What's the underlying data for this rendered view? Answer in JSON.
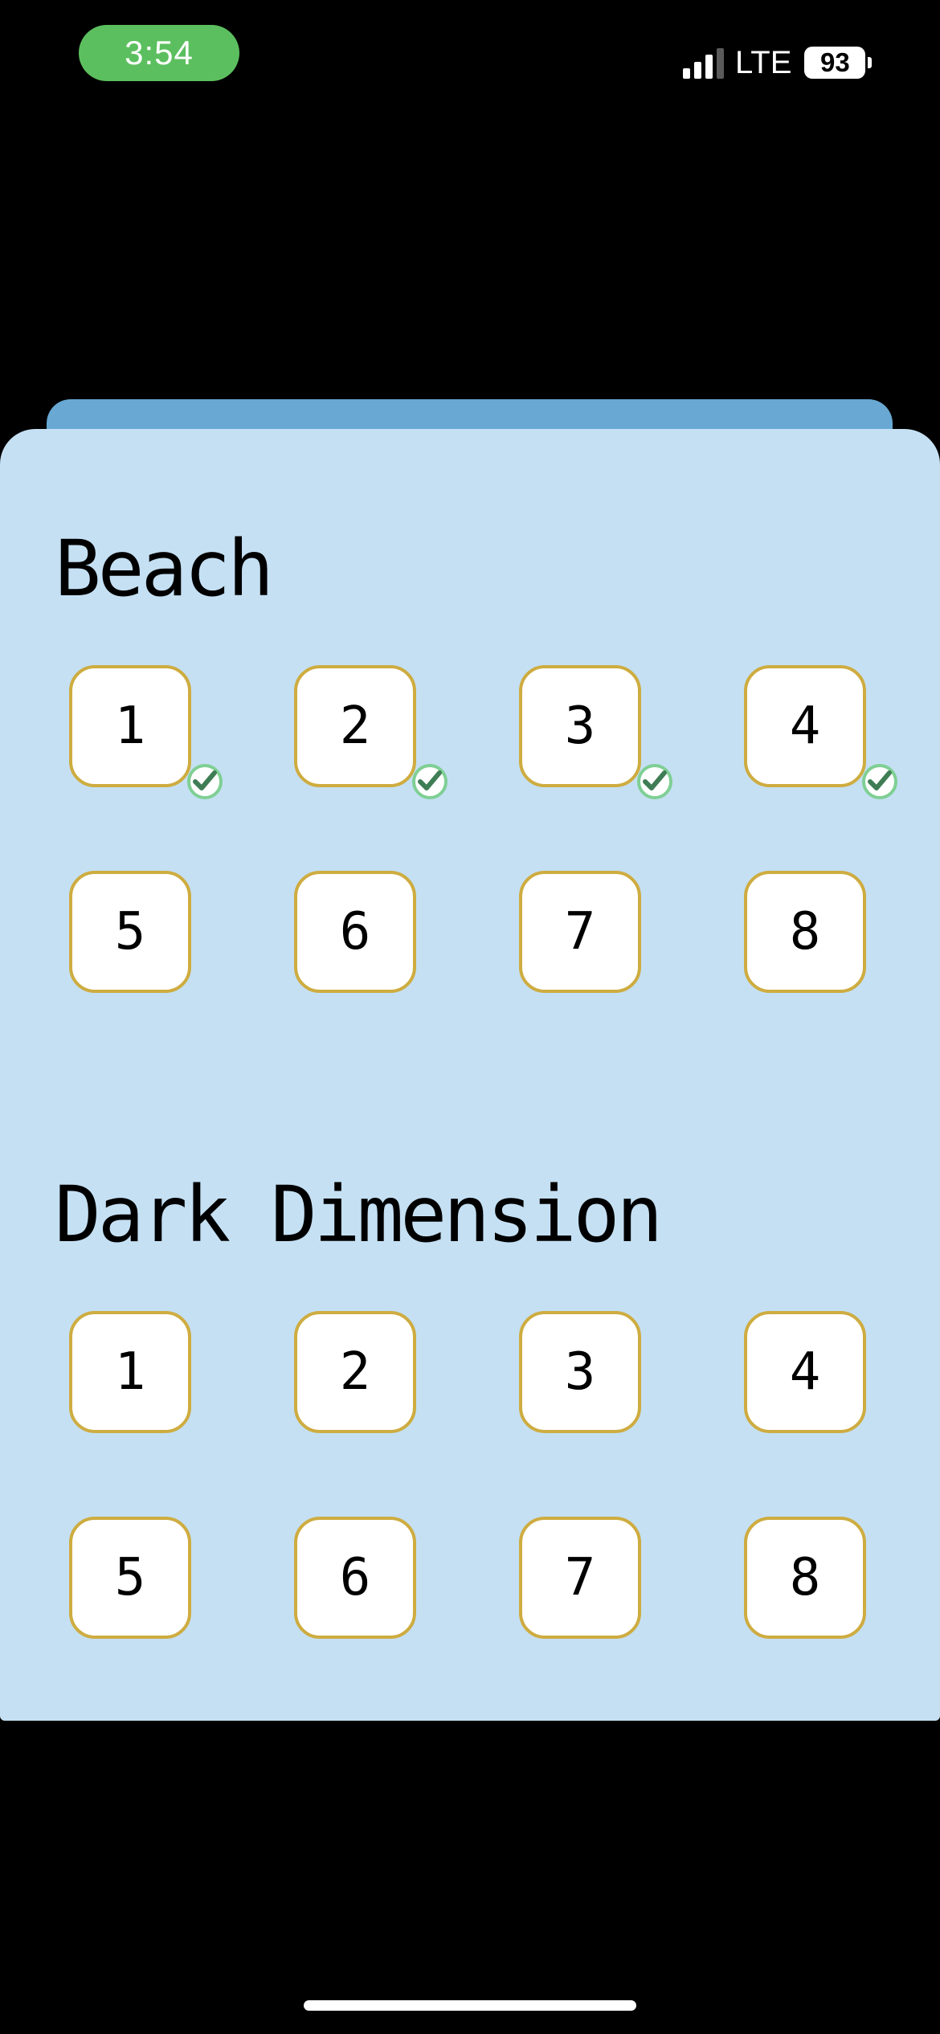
{
  "status_bar": {
    "time": "3:54",
    "network": "LTE",
    "battery": "93",
    "signal_bars_active": 3,
    "signal_bars_total": 4
  },
  "colors": {
    "background": "#000000",
    "time_pill": "#5cbf5f",
    "card": "#c5e0f3",
    "card_tab": "#68a8d3",
    "level_border": "#ceac40",
    "check_fill": "#3f7d55",
    "check_ring": "#7fcf94"
  },
  "worlds": [
    {
      "title": "Beach",
      "levels": [
        {
          "label": "1",
          "completed": true
        },
        {
          "label": "2",
          "completed": true
        },
        {
          "label": "3",
          "completed": true
        },
        {
          "label": "4",
          "completed": true
        },
        {
          "label": "5",
          "completed": false
        },
        {
          "label": "6",
          "completed": false
        },
        {
          "label": "7",
          "completed": false
        },
        {
          "label": "8",
          "completed": false
        }
      ]
    },
    {
      "title": "Dark Dimension",
      "levels": [
        {
          "label": "1",
          "completed": false
        },
        {
          "label": "2",
          "completed": false
        },
        {
          "label": "3",
          "completed": false
        },
        {
          "label": "4",
          "completed": false
        },
        {
          "label": "5",
          "completed": false
        },
        {
          "label": "6",
          "completed": false
        },
        {
          "label": "7",
          "completed": false
        },
        {
          "label": "8",
          "completed": false
        }
      ]
    }
  ],
  "icons": {
    "completed": "check-circle-icon",
    "signal": "cellular-signal-icon",
    "battery": "battery-icon"
  }
}
